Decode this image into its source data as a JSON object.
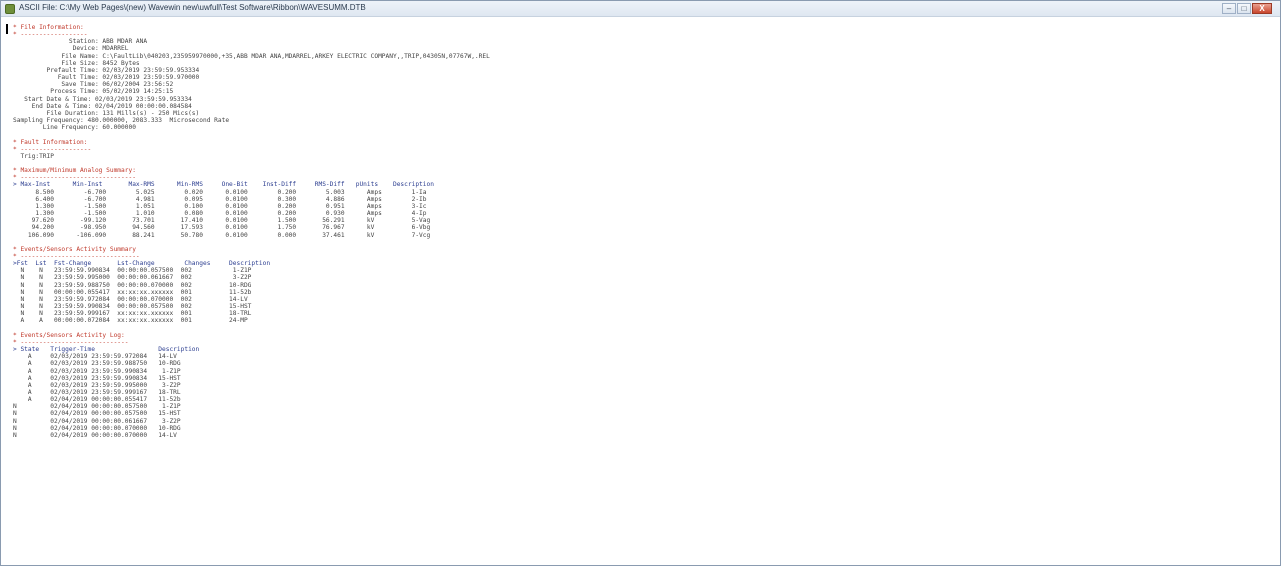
{
  "window": {
    "title": "ASCII File: C:\\My Web Pages\\(new) Wavewin new\\uwfull\\Test Software\\Ribbon\\WAVESUMM.DTB",
    "controls": [
      "minimize",
      "maximize",
      "close"
    ],
    "close_label": "X"
  },
  "colors": {
    "heading": "#c0392b",
    "text": "#444444",
    "header_row": "#2c3e90"
  },
  "lines": [
    {
      "t": "* File Information:",
      "c": "red"
    },
    {
      "t": "* ------------------",
      "c": "red"
    },
    {
      "t": "               Station: ABB MDAR ANA"
    },
    {
      "t": "                Device: MDARREL"
    },
    {
      "t": "             File Name: C:\\FaultLib\\040203,235959970000,+35,ABB MDAR ANA,MDARREL,ARKEY ELECTRIC COMPANY,,TRIP,04305N,07767W,.REL"
    },
    {
      "t": "             File Size: 8452 Bytes"
    },
    {
      "t": "         Prefault Time: 02/03/2019 23:59:59.953334"
    },
    {
      "t": "            Fault Time: 02/03/2019 23:59:59.970000"
    },
    {
      "t": "             Save Time: 06/02/2004 23:56:52"
    },
    {
      "t": "          Process Time: 05/02/2019 14:25:15"
    },
    {
      "t": "   Start Date & Time: 02/03/2019 23:59:59.953334"
    },
    {
      "t": "     End Date & Time: 02/04/2019 00:00:00.084584"
    },
    {
      "t": "         File Duration: 131 Mills(s) - 250 Mics(s)"
    },
    {
      "t": "Sampling Frequency: 480.000000, 2083.333  Microsecond Rate"
    },
    {
      "t": "        Line Frequency: 60.000000"
    },
    {
      "t": ""
    },
    {
      "t": "* Fault Information:",
      "c": "red"
    },
    {
      "t": "* -------------------",
      "c": "red"
    },
    {
      "t": "  Trig:TRIP"
    },
    {
      "t": ""
    },
    {
      "t": "* Maximum/Minimum Analog Summary:",
      "c": "red"
    },
    {
      "t": "* -------------------------------",
      "c": "red"
    },
    {
      "t": "> Max-Inst      Min-Inst       Max-RMS      Min-RMS     One-Bit    Inst-Diff     RMS-Diff   pUnits    Description",
      "c": "blue"
    },
    {
      "t": "      8.500        -6.700        5.025        0.020      0.0100        0.200        5.003      Amps        1-Ia"
    },
    {
      "t": "      6.400        -6.700        4.981        0.095      0.0100        0.300        4.886      Amps        2-Ib"
    },
    {
      "t": "      1.300        -1.500        1.051        0.100      0.0100        0.200        0.951      Amps        3-Ic"
    },
    {
      "t": "      1.300        -1.500        1.010        0.080      0.0100        0.200        0.930      Amps        4-Ip"
    },
    {
      "t": "     97.620       -99.120       73.701       17.410      0.0100        1.500       56.291      kV          5-Vag"
    },
    {
      "t": "     94.200       -98.950       94.560       17.593      0.0100        1.750       76.967      kV          6-Vbg"
    },
    {
      "t": "    106.090      -106.090       88.241       50.780      0.0100        0.000       37.461      kV          7-Vcg"
    },
    {
      "t": ""
    },
    {
      "t": "* Events/Sensors Activity Summary",
      "c": "red"
    },
    {
      "t": "* --------------------------------",
      "c": "red"
    },
    {
      "t": ">Fst  Lst  Fst-Change       Lst-Change        Changes     Description",
      "c": "blue"
    },
    {
      "t": "  N    N   23:59:59.990834  00:00:00.057500  002           1-Z1P"
    },
    {
      "t": "  N    N   23:59:59.995000  00:00:00.061667  002           3-Z2P"
    },
    {
      "t": "  N    N   23:59:59.988750  00:00:00.070000  002          10-RDG"
    },
    {
      "t": "  N    N   00:00:00.055417  xx:xx:xx.xxxxxx  001          11-52b"
    },
    {
      "t": "  N    N   23:59:59.972084  00:00:00.070000  002          14-LV"
    },
    {
      "t": "  N    N   23:59:59.990834  00:00:00.057500  002          15-HST"
    },
    {
      "t": "  N    N   23:59:59.999167  xx:xx:xx.xxxxxx  001          18-TRL"
    },
    {
      "t": "  A    A   00:00:00.072084  xx:xx:xx.xxxxxx  001          24-MP"
    },
    {
      "t": ""
    },
    {
      "t": "* Events/Sensors Activity Log:",
      "c": "red"
    },
    {
      "t": "* -----------------------------",
      "c": "red"
    },
    {
      "t": "> State   Trigger-Time                 Description",
      "c": "blue"
    },
    {
      "t": "    A     02/03/2019 23:59:59.972084   14-LV"
    },
    {
      "t": "    A     02/03/2019 23:59:59.988750   10-RDG"
    },
    {
      "t": "    A     02/03/2019 23:59:59.990834    1-Z1P"
    },
    {
      "t": "    A     02/03/2019 23:59:59.990834   15-HST"
    },
    {
      "t": "    A     02/03/2019 23:59:59.995000    3-Z2P"
    },
    {
      "t": "    A     02/03/2019 23:59:59.999167   18-TRL"
    },
    {
      "t": "    A     02/04/2019 00:00:00.055417   11-52b"
    },
    {
      "t": "N         02/04/2019 00:00:00.057500    1-Z1P"
    },
    {
      "t": "N         02/04/2019 00:00:00.057500   15-HST"
    },
    {
      "t": "N         02/04/2019 00:00:00.061667    3-Z2P"
    },
    {
      "t": "N         02/04/2019 00:00:00.070000   10-RDG"
    },
    {
      "t": "N         02/04/2019 00:00:00.070000   14-LV"
    }
  ]
}
